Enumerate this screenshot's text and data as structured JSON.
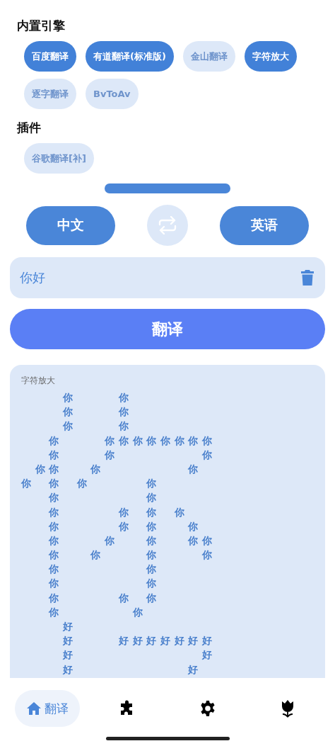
{
  "sections": [
    {
      "title": "内置引擎",
      "engines": [
        {
          "label": "百度翻译",
          "selected": true
        },
        {
          "label": "有道翻译(标准版)",
          "selected": true
        },
        {
          "label": "金山翻译",
          "selected": false
        },
        {
          "label": "字符放大",
          "selected": true
        },
        {
          "label": "逐字翻译",
          "selected": false
        },
        {
          "label": "BvToAv",
          "selected": false
        }
      ]
    },
    {
      "title": "插件",
      "engines": [
        {
          "label": "谷歌翻译[补]",
          "selected": false
        }
      ]
    }
  ],
  "language_bar": {
    "source": "中文",
    "target": "英语"
  },
  "input": {
    "value": "你好"
  },
  "translate_button": "翻译",
  "result": {
    "engine": "字符放大",
    "lines": [
      "　　　你　　　你",
      "　　　你　　　你",
      "　　　你　　　你",
      "　　你　　　你你你你你你你你",
      "　　你　　　你　　　　　　你",
      "　你你　　你　　　　　　你",
      "你　你　你　　　　你",
      "　　你　　　　　　你",
      "　　你　　　　你　你　你",
      "　　你　　　　你　你　　你",
      "　　你　　　你　　你　　你你",
      "　　你　　你　　　你　　　你",
      "　　你　　　　　　你",
      "　　你　　　　　　你",
      "　　你　　　　你　你",
      "　　你　　　　　你",
      "　　　好",
      "　　　好　　　好好好好好好好",
      "　　　好　　　　　　　　　好",
      "　　　好　　　　　　　　好"
    ]
  },
  "nav": [
    {
      "kind": "home",
      "label": "翻译",
      "selected": true
    },
    {
      "kind": "puzzle",
      "selected": false
    },
    {
      "kind": "gear",
      "selected": false
    },
    {
      "kind": "flower",
      "selected": false
    }
  ]
}
